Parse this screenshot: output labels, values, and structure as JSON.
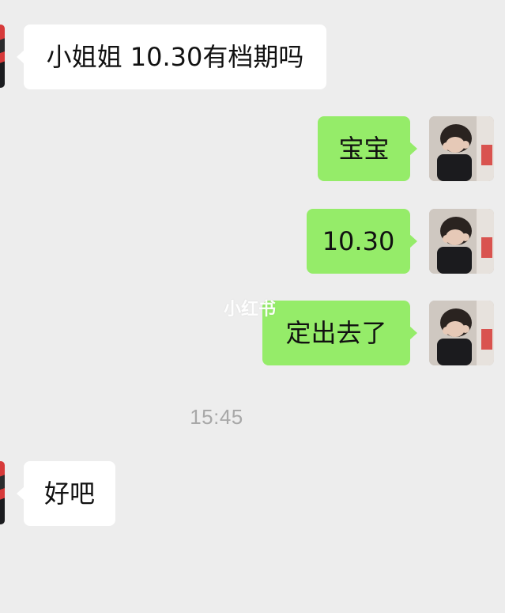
{
  "messages": [
    {
      "side": "left",
      "text": "小姐姐 10.30有档期吗"
    },
    {
      "side": "right",
      "text": "宝宝"
    },
    {
      "side": "right",
      "text": "10.30"
    },
    {
      "side": "right",
      "text": "定出去了"
    },
    {
      "side": "left",
      "text": "好吧"
    }
  ],
  "timestamp": "15:45",
  "watermark": "小红书",
  "colors": {
    "background": "#ededed",
    "incoming_bubble": "#ffffff",
    "outgoing_bubble": "#95ec69",
    "timestamp_text": "#a8a8a8"
  }
}
